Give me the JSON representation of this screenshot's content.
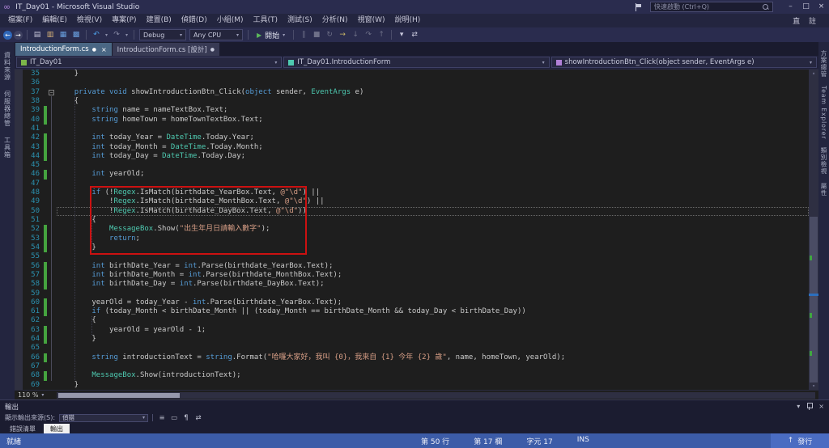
{
  "window": {
    "title": "IT_Day01 - Microsoft Visual Studio",
    "quick_launch": "快速啟動 (Ctrl+Q)",
    "controls": {
      "minimize": "–",
      "maximize": "□",
      "close": "×"
    }
  },
  "menu": {
    "items": [
      "檔案(F)",
      "編輯(E)",
      "檢視(V)",
      "專案(P)",
      "建置(B)",
      "偵錯(D)",
      "小組(M)",
      "工具(T)",
      "測試(S)",
      "分析(N)",
      "視窗(W)",
      "說明(H)"
    ],
    "user_label": "直 註"
  },
  "toolbar": {
    "icons_left": [
      {
        "name": "nav-back-icon",
        "glyph": "←",
        "color": "#2E66B8",
        "circle": true
      },
      {
        "name": "nav-forward-icon",
        "glyph": "→",
        "color": "#3E4060",
        "circle": true
      },
      {
        "name": "sep"
      },
      {
        "name": "new-file-icon",
        "glyph": "▤",
        "color": "#C8C8DC"
      },
      {
        "name": "open-file-icon",
        "glyph": "▥",
        "color": "#DCB67A"
      },
      {
        "name": "save-icon",
        "glyph": "▦",
        "color": "#6AA0E0"
      },
      {
        "name": "save-all-icon",
        "glyph": "▩",
        "color": "#6AA0E0"
      },
      {
        "name": "sep"
      },
      {
        "name": "undo-icon",
        "glyph": "↶",
        "color": "#4EA0E8",
        "chev": true
      },
      {
        "name": "redo-icon",
        "glyph": "↷",
        "color": "#8A8CA8",
        "chev": true
      },
      {
        "name": "sep"
      }
    ],
    "debug_config": "Debug",
    "platform": "Any CPU",
    "start_label": "開始",
    "icons_right": [
      {
        "name": "break-all-icon",
        "glyph": "∥",
        "color": "#6E7088"
      },
      {
        "name": "stop-icon",
        "glyph": "■",
        "color": "#6E7088"
      },
      {
        "name": "restart-icon",
        "glyph": "↻",
        "color": "#6E7088"
      },
      {
        "name": "show-next-statement-icon",
        "glyph": "→",
        "color": "#C8B566"
      },
      {
        "name": "step-into-icon",
        "glyph": "↓",
        "color": "#6E7088"
      },
      {
        "name": "step-over-icon",
        "glyph": "↷",
        "color": "#6E7088"
      },
      {
        "name": "step-out-icon",
        "glyph": "↑",
        "color": "#6E7088"
      },
      {
        "name": "sep"
      },
      {
        "name": "find-in-files-icon",
        "glyph": "▾",
        "color": "#C8C8DC"
      },
      {
        "name": "sync-solution-explorer-icon",
        "glyph": "⇄",
        "color": "#C8C8DC"
      }
    ]
  },
  "side_tabs": {
    "left": [
      "資料來源",
      "伺服器總管",
      "工具箱"
    ],
    "right": [
      "方案總管",
      "Team Explorer",
      "類別檢視",
      "屬性"
    ]
  },
  "doc_tabs": [
    {
      "label": "IntroductionForm.cs",
      "modified": "●",
      "close": "×"
    },
    {
      "label": "IntroductionForm.cs [設計]",
      "modified": "●"
    }
  ],
  "navbar": {
    "project": "IT_Day01",
    "type": "IT_Day01.IntroductionForm",
    "member": "showIntroductionBtn_Click(object sender, EventArgs e)"
  },
  "editor": {
    "zoom": "110 %",
    "first_line": 35,
    "caret_line": 50,
    "green_change_lines": [
      39,
      40,
      42,
      43,
      44,
      46,
      52,
      53,
      54,
      56,
      57,
      58,
      60,
      61,
      63,
      64,
      66,
      68
    ],
    "annotation_box": {
      "from_line": 48,
      "to_line": 54,
      "color": "#CC1111"
    },
    "lines": [
      {
        "n": 35,
        "s": [
          [
            "p",
            "    }"
          ]
        ]
      },
      {
        "n": 36,
        "s": []
      },
      {
        "n": 37,
        "s": [
          [
            "p",
            "    "
          ],
          [
            "k",
            "private"
          ],
          [
            "p",
            " "
          ],
          [
            "k",
            "void"
          ],
          [
            "p",
            " showIntroductionBtn_Click("
          ],
          [
            "k",
            "object"
          ],
          [
            "p",
            " sender, "
          ],
          [
            "t",
            "EventArgs"
          ],
          [
            "p",
            " e)"
          ]
        ]
      },
      {
        "n": 38,
        "s": [
          [
            "p",
            "    {"
          ]
        ]
      },
      {
        "n": 39,
        "s": [
          [
            "p",
            "        "
          ],
          [
            "k",
            "string"
          ],
          [
            "p",
            " name = nameTextBox.Text;"
          ]
        ]
      },
      {
        "n": 40,
        "s": [
          [
            "p",
            "        "
          ],
          [
            "k",
            "string"
          ],
          [
            "p",
            " homeTown = homeTownTextBox.Text;"
          ]
        ]
      },
      {
        "n": 41,
        "s": []
      },
      {
        "n": 42,
        "s": [
          [
            "p",
            "        "
          ],
          [
            "k",
            "int"
          ],
          [
            "p",
            " today_Year = "
          ],
          [
            "t",
            "DateTime"
          ],
          [
            "p",
            ".Today.Year;"
          ]
        ]
      },
      {
        "n": 43,
        "s": [
          [
            "p",
            "        "
          ],
          [
            "k",
            "int"
          ],
          [
            "p",
            " today_Month = "
          ],
          [
            "t",
            "DateTime"
          ],
          [
            "p",
            ".Today.Month;"
          ]
        ]
      },
      {
        "n": 44,
        "s": [
          [
            "p",
            "        "
          ],
          [
            "k",
            "int"
          ],
          [
            "p",
            " today_Day = "
          ],
          [
            "t",
            "DateTime"
          ],
          [
            "p",
            ".Today.Day;"
          ]
        ]
      },
      {
        "n": 45,
        "s": []
      },
      {
        "n": 46,
        "s": [
          [
            "p",
            "        "
          ],
          [
            "k",
            "int"
          ],
          [
            "p",
            " yearOld;"
          ]
        ]
      },
      {
        "n": 47,
        "s": []
      },
      {
        "n": 48,
        "s": [
          [
            "p",
            "        "
          ],
          [
            "k",
            "if"
          ],
          [
            "p",
            " (!"
          ],
          [
            "t",
            "Regex"
          ],
          [
            "p",
            ".IsMatch(birthdate_YearBox.Text, "
          ],
          [
            "s",
            "@\"\\d\""
          ],
          [
            "p",
            ") ||"
          ]
        ]
      },
      {
        "n": 49,
        "s": [
          [
            "p",
            "            !"
          ],
          [
            "t",
            "Regex"
          ],
          [
            "p",
            ".IsMatch(birthdate_MonthBox.Text, "
          ],
          [
            "s",
            "@\"\\d\""
          ],
          [
            "p",
            ") ||"
          ]
        ]
      },
      {
        "n": 50,
        "s": [
          [
            "p",
            "            !"
          ],
          [
            "t",
            "Regex"
          ],
          [
            "p",
            ".IsMatch(birthdate_DayBox.Text, "
          ],
          [
            "s",
            "@\"\\d\""
          ],
          [
            "p",
            "))"
          ]
        ]
      },
      {
        "n": 51,
        "s": [
          [
            "p",
            "        {"
          ]
        ]
      },
      {
        "n": 52,
        "s": [
          [
            "p",
            "            "
          ],
          [
            "t",
            "MessageBox"
          ],
          [
            "p",
            ".Show("
          ],
          [
            "s",
            "\"出生年月日請輸入數字\""
          ],
          [
            "p",
            ");"
          ]
        ]
      },
      {
        "n": 53,
        "s": [
          [
            "p",
            "            "
          ],
          [
            "k",
            "return"
          ],
          [
            "p",
            ";"
          ]
        ]
      },
      {
        "n": 54,
        "s": [
          [
            "p",
            "        }"
          ]
        ]
      },
      {
        "n": 55,
        "s": []
      },
      {
        "n": 56,
        "s": [
          [
            "p",
            "        "
          ],
          [
            "k",
            "int"
          ],
          [
            "p",
            " birthDate_Year = "
          ],
          [
            "k",
            "int"
          ],
          [
            "p",
            ".Parse(birthdate_YearBox.Text);"
          ]
        ]
      },
      {
        "n": 57,
        "s": [
          [
            "p",
            "        "
          ],
          [
            "k",
            "int"
          ],
          [
            "p",
            " birthDate_Month = "
          ],
          [
            "k",
            "int"
          ],
          [
            "p",
            ".Parse(birthdate_MonthBox.Text);"
          ]
        ]
      },
      {
        "n": 58,
        "s": [
          [
            "p",
            "        "
          ],
          [
            "k",
            "int"
          ],
          [
            "p",
            " birthDate_Day = "
          ],
          [
            "k",
            "int"
          ],
          [
            "p",
            ".Parse(birthdate_DayBox.Text);"
          ]
        ]
      },
      {
        "n": 59,
        "s": []
      },
      {
        "n": 60,
        "s": [
          [
            "p",
            "        yearOld = today_Year - "
          ],
          [
            "k",
            "int"
          ],
          [
            "p",
            ".Parse(birthdate_YearBox.Text);"
          ]
        ]
      },
      {
        "n": 61,
        "s": [
          [
            "p",
            "        "
          ],
          [
            "k",
            "if"
          ],
          [
            "p",
            " (today_Month < birthDate_Month || (today_Month == birthDate_Month && today_Day < birthDate_Day))"
          ]
        ]
      },
      {
        "n": 62,
        "s": [
          [
            "p",
            "        {"
          ]
        ]
      },
      {
        "n": 63,
        "s": [
          [
            "p",
            "            yearOld = yearOld - 1;"
          ]
        ]
      },
      {
        "n": 64,
        "s": [
          [
            "p",
            "        }"
          ]
        ]
      },
      {
        "n": 65,
        "s": []
      },
      {
        "n": 66,
        "s": [
          [
            "p",
            "        "
          ],
          [
            "k",
            "string"
          ],
          [
            "p",
            " introductionText = "
          ],
          [
            "k",
            "string"
          ],
          [
            "p",
            ".Format("
          ],
          [
            "s",
            "\"哈囉大家好，我叫 {0}，我來自 {1} 今年 {2} 歲\""
          ],
          [
            "p",
            ", name, homeTown, yearOld);"
          ]
        ]
      },
      {
        "n": 67,
        "s": []
      },
      {
        "n": 68,
        "s": [
          [
            "p",
            "        "
          ],
          [
            "t",
            "MessageBox"
          ],
          [
            "p",
            ".Show(introductionText);"
          ]
        ]
      },
      {
        "n": 69,
        "s": [
          [
            "p",
            "    }"
          ]
        ]
      }
    ]
  },
  "output": {
    "title": "輸出",
    "source_label": "顯示輸出來源(S):",
    "source_value": "偵錯",
    "toolbar_icons": [
      {
        "name": "output-messages-icon",
        "glyph": "≡"
      },
      {
        "name": "clear-all-icon",
        "glyph": "▭"
      },
      {
        "name": "toggle-word-wrap-icon",
        "glyph": "¶"
      },
      {
        "name": "go-to-message-icon",
        "glyph": "⇄"
      }
    ],
    "bottom_tabs": [
      {
        "label": "錯誤清單",
        "active": false
      },
      {
        "label": "輸出",
        "active": true
      }
    ]
  },
  "status": {
    "state": "就緒",
    "line": "第 50 行",
    "column": "第 17 欄",
    "char": "字元 17",
    "mode": "INS",
    "publish": "發行"
  }
}
